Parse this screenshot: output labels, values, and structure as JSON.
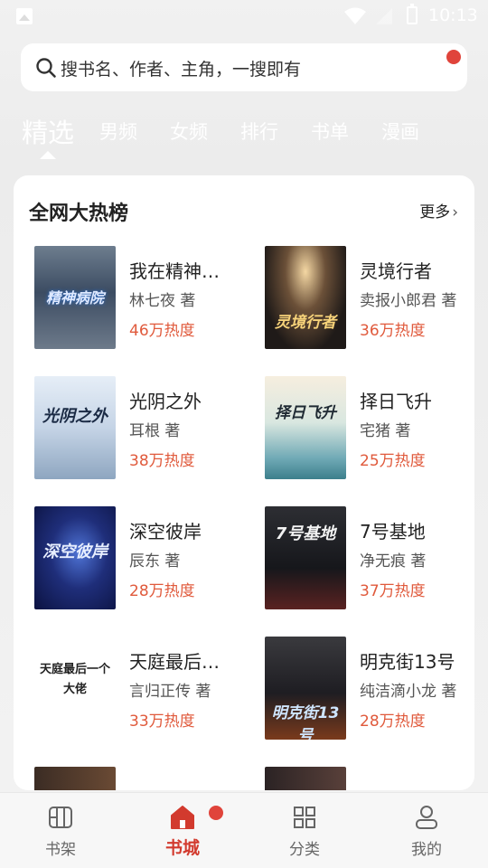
{
  "status_bar": {
    "time": "10:13"
  },
  "search": {
    "placeholder": "搜书名、作者、主角，一搜即有"
  },
  "tabs": [
    {
      "label": "精选",
      "active": true
    },
    {
      "label": "男频"
    },
    {
      "label": "女频"
    },
    {
      "label": "排行"
    },
    {
      "label": "书单"
    },
    {
      "label": "漫画"
    }
  ],
  "ranking": {
    "title": "全网大热榜",
    "more_label": "更多",
    "books": [
      {
        "name": "我在精神…",
        "author": "林七夜 著",
        "heat": "46万热度",
        "cover_text": "精神病院"
      },
      {
        "name": "灵境行者",
        "author": "卖报小郎君 著",
        "heat": "36万热度",
        "cover_text": "灵境行者"
      },
      {
        "name": "光阴之外",
        "author": "耳根 著",
        "heat": "38万热度",
        "cover_text": "光阴之外"
      },
      {
        "name": "择日飞升",
        "author": "宅猪 著",
        "heat": "25万热度",
        "cover_text": "择日飞升"
      },
      {
        "name": "深空彼岸",
        "author": "辰东 著",
        "heat": "28万热度",
        "cover_text": "深空彼岸"
      },
      {
        "name": "7号基地",
        "author": "净无痕 著",
        "heat": "37万热度",
        "cover_text": "7号基地"
      },
      {
        "name": "天庭最后…",
        "author": "言归正传 著",
        "heat": "33万热度",
        "cover_text": "天庭最后一个大佬"
      },
      {
        "name": "明克街13号",
        "author": "纯洁滴小龙 著",
        "heat": "28万热度",
        "cover_text": "明克街13号"
      }
    ]
  },
  "bottom_nav": [
    {
      "label": "书架",
      "icon": "bookshelf-icon"
    },
    {
      "label": "书城",
      "icon": "bookstore-icon",
      "active": true
    },
    {
      "label": "分类",
      "icon": "category-icon"
    },
    {
      "label": "我的",
      "icon": "profile-icon"
    }
  ],
  "colors": {
    "accent": "#d23a2e",
    "heat": "#e05a3c",
    "badge": "#e0443b"
  }
}
